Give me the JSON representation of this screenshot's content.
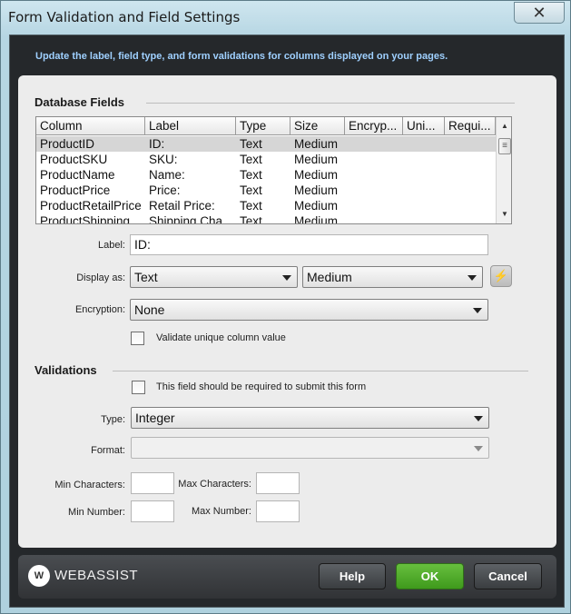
{
  "window": {
    "title": "Form Validation and Field Settings",
    "close_glyph": "✕"
  },
  "intro": "Update the label, field type, and form validations for columns displayed on your pages.",
  "database_fields": {
    "heading": "Database Fields",
    "columns": [
      "Column",
      "Label",
      "Type",
      "Size",
      "Encryp...",
      "Uni...",
      "Requi..."
    ],
    "rows": [
      [
        "ProductID",
        "ID:",
        "Text",
        "Medium",
        "",
        "",
        ""
      ],
      [
        "ProductSKU",
        "SKU:",
        "Text",
        "Medium",
        "",
        "",
        ""
      ],
      [
        "ProductName",
        "Name:",
        "Text",
        "Medium",
        "",
        "",
        ""
      ],
      [
        "ProductPrice",
        "Price:",
        "Text",
        "Medium",
        "",
        "",
        ""
      ],
      [
        "ProductRetailPrice",
        "Retail Price:",
        "Text",
        "Medium",
        "",
        "",
        ""
      ],
      [
        "ProductShipping",
        "Shipping Cha...",
        "Text",
        "Medium",
        "",
        "",
        ""
      ]
    ],
    "selected_row": 0
  },
  "field": {
    "label_caption": "Label:",
    "label_value": "ID:",
    "display_caption": "Display as:",
    "display_type": "Text",
    "display_size": "Medium",
    "encryption_caption": "Encryption:",
    "encryption_value": "None",
    "unique_label": "Validate unique column value"
  },
  "validations": {
    "heading": "Validations",
    "required_label": "This field should be required to submit this form",
    "type_caption": "Type:",
    "type_value": "Integer",
    "format_caption": "Format:",
    "format_value": "",
    "min_chars_caption": "Min Characters:",
    "max_chars_caption": "Max Characters:",
    "min_number_caption": "Min Number:",
    "max_number_caption": "Max Number:"
  },
  "footer": {
    "logo_mark": "W",
    "logo_text": "WEBASSIST",
    "help": "Help",
    "ok": "OK",
    "cancel": "Cancel"
  }
}
